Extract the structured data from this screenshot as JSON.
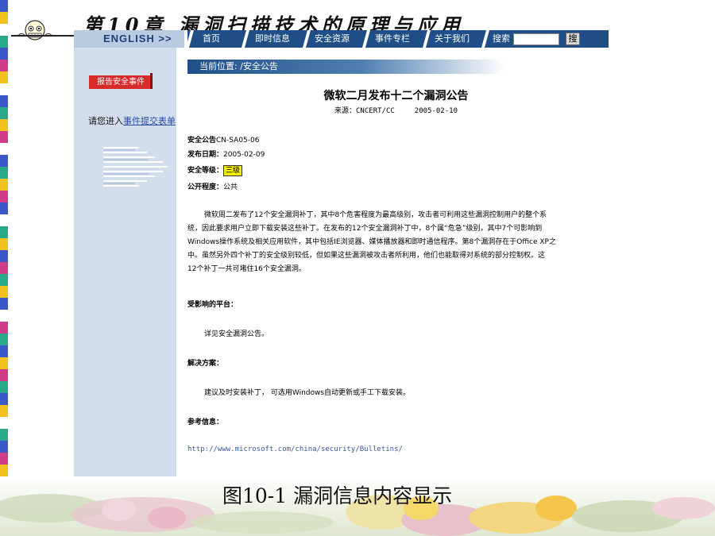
{
  "slide": {
    "chapter_title": "第10章  漏洞扫描技术的原理与应用",
    "caption": "图10-1 漏洞信息内容显示"
  },
  "nav": {
    "english_label": "ENGLISH  >>",
    "items": [
      "首页",
      "即时信息",
      "安全资源",
      "事件专栏",
      "关于我们"
    ],
    "search_label": "搜索",
    "search_value": "",
    "search_button": "搜"
  },
  "sidebar": {
    "report_tab": "报告安全事件",
    "enter_prefix": "请您进入",
    "enter_link": "事件提交表单"
  },
  "breadcrumb": "当前位置: /安全公告",
  "article": {
    "title": "微软二月发布十二个漏洞公告",
    "source": "来源：CNCERT/CC",
    "date": "2005-02-10",
    "bulletin_label": "安全公告",
    "bulletin_value": "CN-SA05-06",
    "published_label": "发布日期：",
    "published_value": "2005-02-09",
    "level_label": "安全等级：",
    "level_value": "三级",
    "public_label": "公开程度：",
    "public_value": "公共",
    "body_lines": [
      "微软周二发布了12个安全漏洞补丁，其中8个危害程度为最高级别，攻击者可利用这些漏洞控制用户的整个系",
      "统，因此要求用户立即下载安装这些补丁。在发布的12个安全漏洞补丁中，8个属“危急”级别，其中7个可影响到",
      "Windows操作系统及相关应用软件，其中包括IE浏览器、媒体播放器和即时通信程序。第8个漏洞存在于Office XP之",
      "中。虽然另外四个补丁的安全级别较低，但如果这些漏洞被攻击者所利用，他们也能取得对系统的部分控制权。这",
      "12个补丁一共可堵住16个安全漏洞。"
    ],
    "affected_heading": "受影响的平台：",
    "affected_text": "详见安全漏洞公告。",
    "solution_heading": "解决方案：",
    "solution_text": "建议及时安装补丁，  可选用Windows自动更新或手工下载安装。",
    "reference_heading": "参考信息：",
    "reference_link": "http://www.microsoft.com/china/security/Bulletins/"
  },
  "colors": {
    "nav_bg": "#1f4f86",
    "sidebar_bg": "#d2deec",
    "report_tab_bg": "#d82a2a",
    "level_badge_bg": "#f6ee00"
  }
}
